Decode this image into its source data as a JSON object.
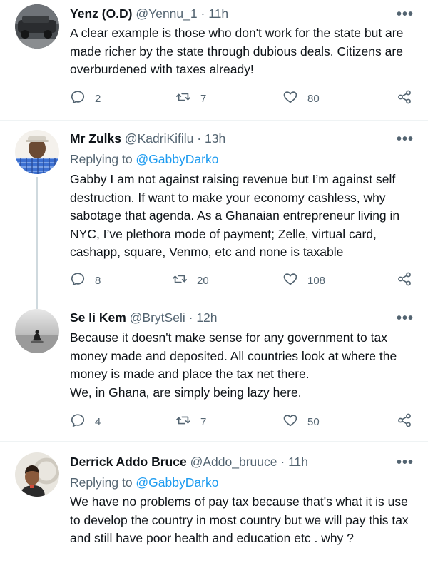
{
  "tweets": [
    {
      "name": "Yenz (O.D)",
      "handle": "@Yennu_1",
      "separator": "·",
      "time": "11h",
      "more": "•••",
      "body": [
        "A clear example is those who don't work for the state but are made richer by the state through dubious deals. Citizens are overburdened with taxes already!"
      ],
      "replies": "2",
      "retweets": "7",
      "likes": "80"
    },
    {
      "name": "Mr Zulks",
      "handle": "@KadriKifilu",
      "separator": "·",
      "time": "13h",
      "more": "•••",
      "reply_prefix": "Replying to ",
      "reply_mention": "@GabbyDarko",
      "body": [
        "Gabby I am not against raising revenue but I’m against self destruction. If want to make your economy cashless, why sabotage that agenda. As a Ghanaian entrepreneur living in NYC, I’ve plethora mode of payment; Zelle, virtual card, cashapp, square, Venmo, etc and none is taxable"
      ],
      "replies": "8",
      "retweets": "20",
      "likes": "108"
    },
    {
      "name": "Se li Kem",
      "handle": "@BrytSeli",
      "separator": "·",
      "time": "12h",
      "more": "•••",
      "body": [
        "Because it doesn't make sense for any government to tax money made and deposited. All countries look at where the money is made and place the tax net there.",
        "We, in Ghana, are simply being lazy here."
      ],
      "replies": "4",
      "retweets": "7",
      "likes": "50"
    },
    {
      "name": "Derrick Addo Bruce",
      "handle": "@Addo_bruuce",
      "separator": "·",
      "time": "11h",
      "more": "•••",
      "reply_prefix": "Replying to ",
      "reply_mention": "@GabbyDarko",
      "body": [
        "We have no problems of pay tax because that's what it is use to develop  the country in most country but we will pay this tax and still have poor health and education etc . why ?"
      ]
    }
  ],
  "icons": {
    "reply": "reply-icon",
    "retweet": "retweet-icon",
    "like": "heart-icon",
    "share": "share-icon",
    "more": "more-icon"
  },
  "colors": {
    "link": "#1d9bf0",
    "secondary": "#536471",
    "text": "#0f1419",
    "divider": "#eff3f4"
  }
}
